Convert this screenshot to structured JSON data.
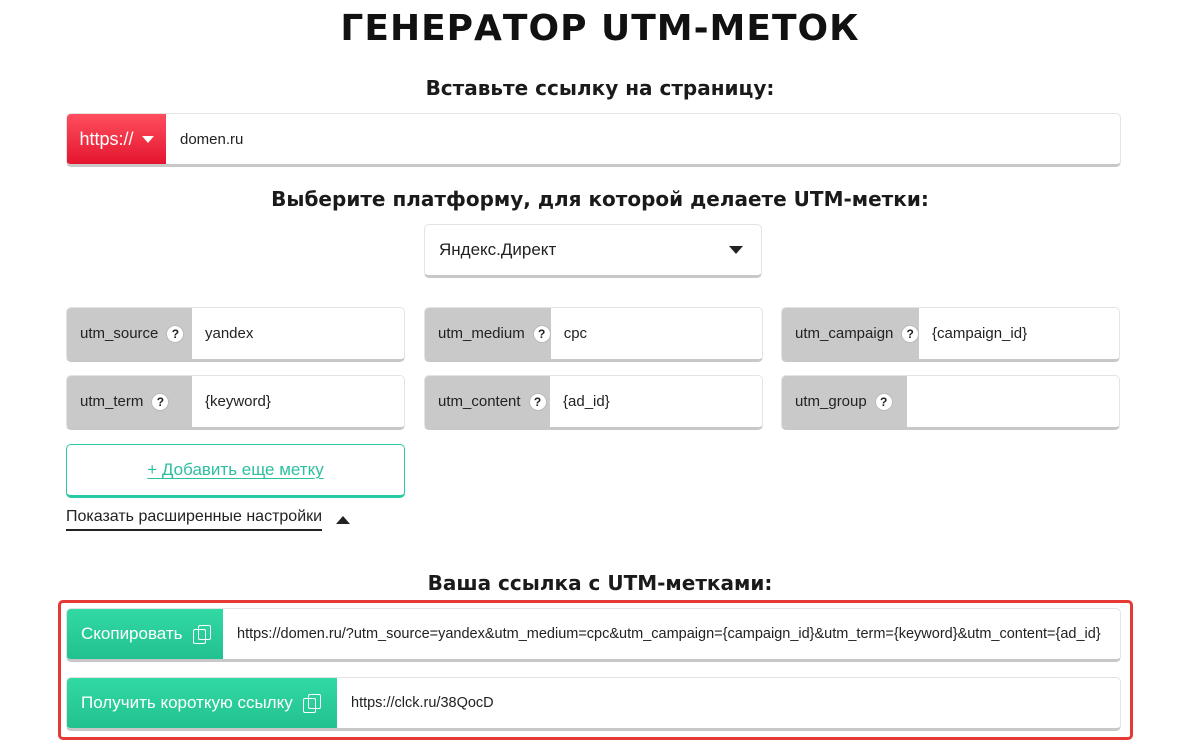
{
  "title": "ГЕНЕРАТОР UTM-МЕТОК",
  "url_section": {
    "heading": "Вставьте ссылку на страницу:",
    "protocol": "https://",
    "url_value": "domen.ru"
  },
  "platform_section": {
    "heading": "Выберите платформу, для которой делаете UTM-метки:",
    "selected": "Яндекс.Директ"
  },
  "utm_fields": [
    {
      "label": "utm_source",
      "value": "yandex"
    },
    {
      "label": "utm_medium",
      "value": "cpc"
    },
    {
      "label": "utm_campaign",
      "value": "{campaign_id}"
    },
    {
      "label": "utm_term",
      "value": "{keyword}"
    },
    {
      "label": "utm_content",
      "value": "{ad_id}"
    },
    {
      "label": "utm_group",
      "value": ""
    }
  ],
  "help_glyph": "?",
  "add_tag_label": "+ Добавить еще метку",
  "advanced_label": "Показать расширенные настройки",
  "result_section": {
    "heading": "Ваша ссылка с UTM-метками:",
    "copy_label": "Скопировать",
    "full_url": "https://domen.ru/?utm_source=yandex&utm_medium=cpc&utm_campaign={campaign_id}&utm_term={keyword}&utm_content={ad_id}",
    "short_label": "Получить короткую ссылку",
    "short_url": "https://clck.ru/38QocD"
  },
  "colors": {
    "protocol_red": "#e4162e",
    "accent_green": "#22c190",
    "highlight_red": "#e53935",
    "label_gray": "#c9c9c9"
  },
  "icons": {
    "protocol_dropdown": "chevron-down-icon",
    "platform_dropdown": "chevron-down-icon",
    "advanced_toggle": "chevron-up-icon",
    "copy": "copy-icon",
    "help": "help-icon"
  }
}
